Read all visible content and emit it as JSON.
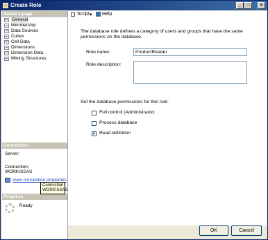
{
  "window": {
    "title": "Create Role"
  },
  "left": {
    "select_page_header": "Select a page",
    "pages": [
      "General",
      "Membership",
      "Data Sources",
      "Cubes",
      "Cell Data",
      "Dimensions",
      "Dimension Data",
      "Mining Structures"
    ],
    "connection_header": "Connection",
    "server_label": "Server:",
    "server_value": ".",
    "connection_label": "Connection:",
    "connection_value": "WORK\\SSAS",
    "view_link": "View connection properties",
    "tooltip_line1": "Connection:",
    "tooltip_line2": "WORK\\SSAS",
    "progress_header": "Progress",
    "progress_status": "Ready"
  },
  "toolbar": {
    "script_label": "Script",
    "help_label": "Help"
  },
  "main": {
    "description": "The database role defines a category of users and groups that have the same permissions on the database.",
    "role_name_label": "Role name:",
    "role_name_value": "ProductReader",
    "role_desc_label": "Role description:",
    "role_desc_value": "",
    "perm_title": "Set the database permissions for this role:",
    "perm_full": "Full control (Administrator)",
    "perm_process": "Process database",
    "perm_read": "Read definition",
    "perm_read_check": "✔"
  },
  "buttons": {
    "ok": "OK",
    "cancel": "Cancel"
  }
}
